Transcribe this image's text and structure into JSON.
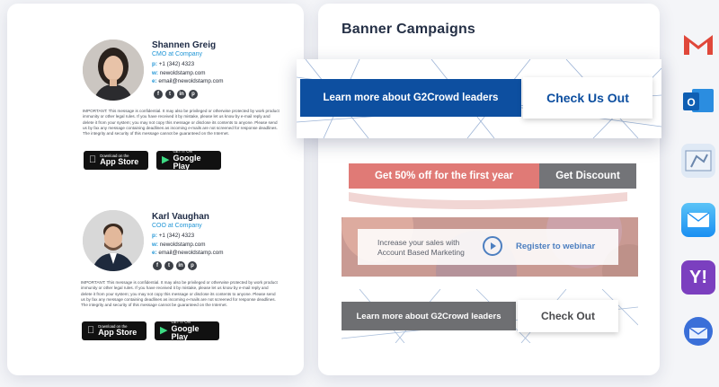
{
  "signatures": [
    {
      "name": "Shannen Greig",
      "role": "CMO at Company",
      "phone_label": "p:",
      "phone": "+1 (342) 4323",
      "web_label": "w:",
      "web": "newoldstamp.com",
      "email_label": "e:",
      "email": "email@newoldstamp.com",
      "socials": [
        "f",
        "t",
        "in",
        "p"
      ],
      "disclaimer": "IMPORTANT: This message is confidential. It may also be privileged or otherwise protected by work product immunity or other legal rules. If you have received it by mistake, please let us know by e-mail reply and delete it from your system; you may not copy this message or disclose its contents to anyone. Please send us by fax any message containing deadlines as incoming e-mails are not screened for response deadlines. The integrity and security of this message cannot be guaranteed on the Internet.",
      "app_store": {
        "small": "Download on the",
        "big": "App Store"
      },
      "google_play": {
        "small": "GET IT ON",
        "big": "Google Play"
      }
    },
    {
      "name": "Karl Vaughan",
      "role": "COO at Company",
      "phone_label": "p:",
      "phone": "+1 (342) 4323",
      "web_label": "w:",
      "web": "newoldstamp.com",
      "email_label": "e:",
      "email": "email@newoldstamp.com",
      "socials": [
        "f",
        "t",
        "in",
        "p"
      ],
      "disclaimer": "IMPORTANT: This message is confidential. It may also be privileged or otherwise protected by work product immunity or other legal rules. If you have received it by mistake, please let us know by e-mail reply and delete it from your system; you may not copy this message or disclose its contents to anyone. Please send us by fax any message containing deadlines as incoming e-mails are not screened for response deadlines. The integrity and security of this message cannot be guaranteed on the Internet.",
      "app_store": {
        "small": "Download on the",
        "big": "App Store"
      },
      "google_play": {
        "small": "GET IT ON",
        "big": "Google Play"
      }
    }
  ],
  "banners": {
    "title": "Banner Campaigns",
    "g2crowd_primary": {
      "text": "Learn more about G2Crowd leaders",
      "cta": "Check Us Out",
      "color": "#0d4fa0"
    },
    "discount": {
      "text": "Get 50% off for the first year",
      "cta": "Get Discount",
      "color": "#e07a76"
    },
    "webinar": {
      "line1": "Increase your sales with",
      "line2": "Account Based Marketing",
      "cta": "Register to webinar"
    },
    "g2crowd_secondary": {
      "text": "Learn more about G2Crowd leaders",
      "cta": "Check Out"
    }
  },
  "email_clients": [
    "gmail-icon",
    "outlook-icon",
    "apple-mail-icon",
    "mail-icon",
    "yahoo-icon",
    "thunderbird-icon"
  ],
  "colors": {
    "accent_blue": "#1f95d6",
    "dark_navy": "#253046"
  }
}
